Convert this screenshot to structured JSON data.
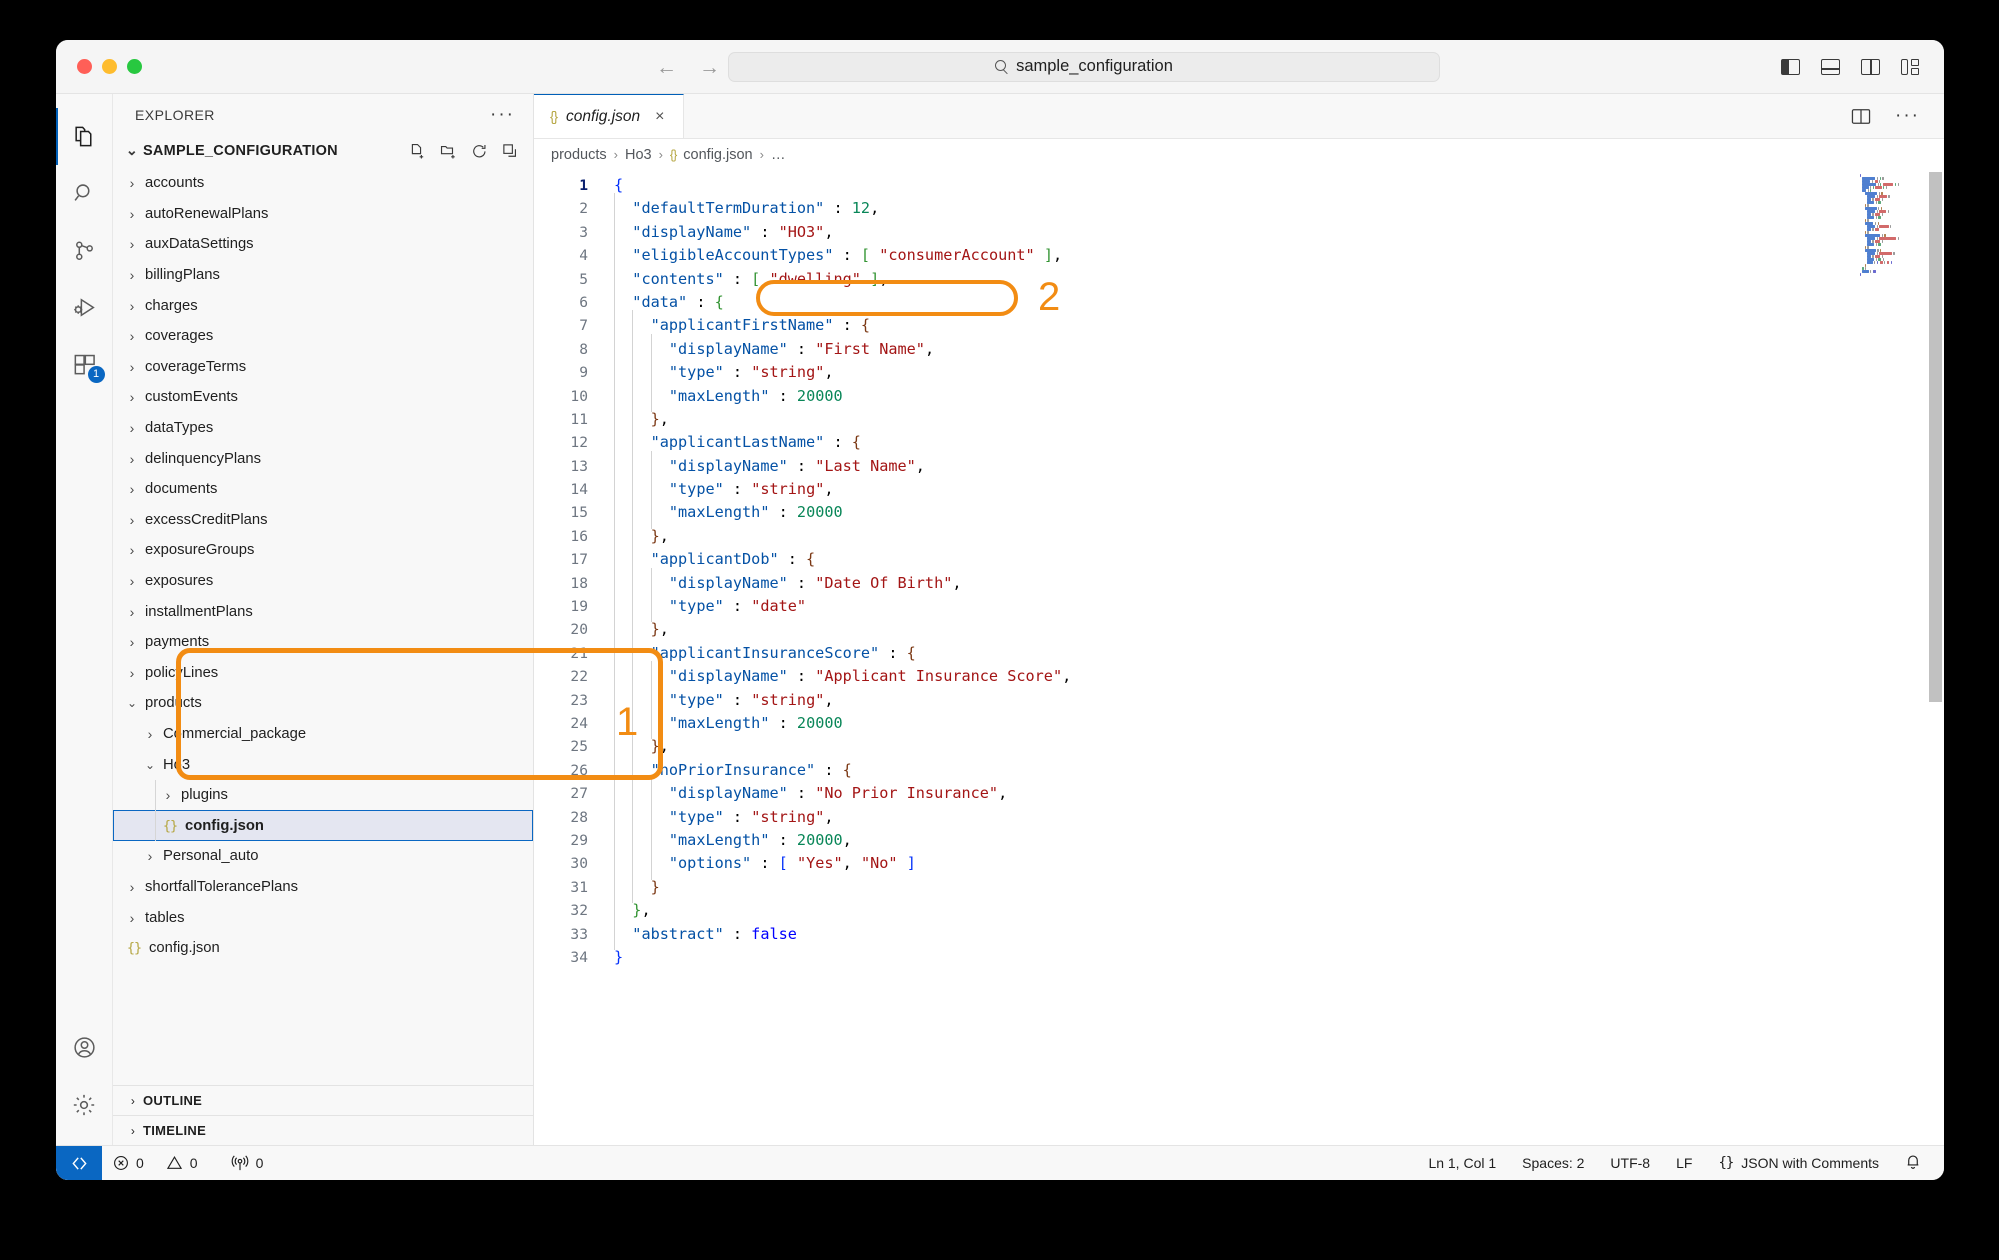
{
  "window": {
    "traffic_lights": [
      "close",
      "minimize",
      "maximize"
    ]
  },
  "titlebar": {
    "back_arrow": "←",
    "forward_arrow": "→",
    "quick_input_value": "sample_configuration",
    "search_icon": "search-icon",
    "layout_icons": [
      "toggle-primary-sidebar-icon",
      "toggle-panel-icon",
      "toggle-secondary-sidebar-icon",
      "customize-layout-icon"
    ]
  },
  "activitybar": {
    "items": [
      {
        "name": "explorer",
        "icon": "files-icon",
        "active": true,
        "badge": ""
      },
      {
        "name": "search",
        "icon": "search-icon",
        "active": false,
        "badge": ""
      },
      {
        "name": "source-control",
        "icon": "source-control-icon",
        "active": false,
        "badge": ""
      },
      {
        "name": "run-and-debug",
        "icon": "run-debug-icon",
        "active": false,
        "badge": ""
      },
      {
        "name": "extensions",
        "icon": "extensions-icon",
        "active": false,
        "badge": "1"
      }
    ],
    "bottom": [
      {
        "name": "accounts",
        "icon": "account-icon"
      },
      {
        "name": "manage",
        "icon": "gear-icon"
      }
    ]
  },
  "sidebar": {
    "title": "EXPLORER",
    "more_actions": "···",
    "root": {
      "label": "SAMPLE_CONFIGURATION",
      "expanded": true,
      "actions": [
        "new-file-icon",
        "new-folder-icon",
        "refresh-icon",
        "collapse-all-icon"
      ]
    },
    "tree": [
      {
        "label": "accounts",
        "type": "folder",
        "depth": 1,
        "expanded": false
      },
      {
        "label": "autoRenewalPlans",
        "type": "folder",
        "depth": 1,
        "expanded": false
      },
      {
        "label": "auxDataSettings",
        "type": "folder",
        "depth": 1,
        "expanded": false
      },
      {
        "label": "billingPlans",
        "type": "folder",
        "depth": 1,
        "expanded": false
      },
      {
        "label": "charges",
        "type": "folder",
        "depth": 1,
        "expanded": false
      },
      {
        "label": "coverages",
        "type": "folder",
        "depth": 1,
        "expanded": false
      },
      {
        "label": "coverageTerms",
        "type": "folder",
        "depth": 1,
        "expanded": false
      },
      {
        "label": "customEvents",
        "type": "folder",
        "depth": 1,
        "expanded": false
      },
      {
        "label": "dataTypes",
        "type": "folder",
        "depth": 1,
        "expanded": false
      },
      {
        "label": "delinquencyPlans",
        "type": "folder",
        "depth": 1,
        "expanded": false
      },
      {
        "label": "documents",
        "type": "folder",
        "depth": 1,
        "expanded": false
      },
      {
        "label": "excessCreditPlans",
        "type": "folder",
        "depth": 1,
        "expanded": false
      },
      {
        "label": "exposureGroups",
        "type": "folder",
        "depth": 1,
        "expanded": false
      },
      {
        "label": "exposures",
        "type": "folder",
        "depth": 1,
        "expanded": false
      },
      {
        "label": "installmentPlans",
        "type": "folder",
        "depth": 1,
        "expanded": false
      },
      {
        "label": "payments",
        "type": "folder",
        "depth": 1,
        "expanded": false
      },
      {
        "label": "policyLines",
        "type": "folder",
        "depth": 1,
        "expanded": false
      },
      {
        "label": "products",
        "type": "folder",
        "depth": 1,
        "expanded": true
      },
      {
        "label": "Commercial_package",
        "type": "folder",
        "depth": 2,
        "expanded": false
      },
      {
        "label": "Ho3",
        "type": "folder",
        "depth": 2,
        "expanded": true
      },
      {
        "label": "plugins",
        "type": "folder",
        "depth": 3,
        "expanded": false
      },
      {
        "label": "config.json",
        "type": "json",
        "depth": 3,
        "selected": true
      },
      {
        "label": "Personal_auto",
        "type": "folder",
        "depth": 2,
        "expanded": false
      },
      {
        "label": "shortfallTolerancePlans",
        "type": "folder",
        "depth": 1,
        "expanded": false
      },
      {
        "label": "tables",
        "type": "folder",
        "depth": 1,
        "expanded": false
      },
      {
        "label": "config.json",
        "type": "json",
        "depth": 1
      }
    ],
    "bottom_panels": [
      {
        "label": "OUTLINE",
        "expanded": false
      },
      {
        "label": "TIMELINE",
        "expanded": false
      }
    ]
  },
  "editor": {
    "tabs": [
      {
        "label": "config.json",
        "icon": "json-icon",
        "active": true,
        "dirty": false,
        "close_label": "×"
      }
    ],
    "tab_actions": [
      "split-editor-icon",
      "more-actions-icon"
    ],
    "breadcrumb": [
      "products",
      "Ho3",
      "config.json",
      "…"
    ],
    "breadcrumb_separator": "›",
    "code_lines": [
      {
        "n": 1,
        "indent": 0,
        "tokens": [
          {
            "t": "{",
            "c": "br1"
          }
        ]
      },
      {
        "n": 2,
        "indent": 1,
        "tokens": [
          {
            "t": "\"defaultTermDuration\"",
            "c": "k"
          },
          {
            "t": " : ",
            "c": "p"
          },
          {
            "t": "12",
            "c": "n"
          },
          {
            "t": ",",
            "c": "p"
          }
        ]
      },
      {
        "n": 3,
        "indent": 1,
        "tokens": [
          {
            "t": "\"displayName\"",
            "c": "k"
          },
          {
            "t": " : ",
            "c": "p"
          },
          {
            "t": "\"HO3\"",
            "c": "s"
          },
          {
            "t": ",",
            "c": "p"
          }
        ]
      },
      {
        "n": 4,
        "indent": 1,
        "tokens": [
          {
            "t": "\"eligibleAccountTypes\"",
            "c": "k"
          },
          {
            "t": " : ",
            "c": "p"
          },
          {
            "t": "[",
            "c": "br2"
          },
          {
            "t": " ",
            "c": "p"
          },
          {
            "t": "\"consumerAccount\"",
            "c": "s"
          },
          {
            "t": " ",
            "c": "p"
          },
          {
            "t": "]",
            "c": "br2"
          },
          {
            "t": ",",
            "c": "p"
          }
        ]
      },
      {
        "n": 5,
        "indent": 1,
        "tokens": [
          {
            "t": "\"contents\"",
            "c": "k"
          },
          {
            "t": " : ",
            "c": "p"
          },
          {
            "t": "[",
            "c": "br2"
          },
          {
            "t": " ",
            "c": "p"
          },
          {
            "t": "\"dwelling\"",
            "c": "s"
          },
          {
            "t": " ",
            "c": "p"
          },
          {
            "t": "]",
            "c": "br2"
          },
          {
            "t": ",",
            "c": "p"
          }
        ]
      },
      {
        "n": 6,
        "indent": 1,
        "tokens": [
          {
            "t": "\"data\"",
            "c": "k"
          },
          {
            "t": " : ",
            "c": "p"
          },
          {
            "t": "{",
            "c": "br2"
          }
        ]
      },
      {
        "n": 7,
        "indent": 2,
        "tokens": [
          {
            "t": "\"applicantFirstName\"",
            "c": "k"
          },
          {
            "t": " : ",
            "c": "p"
          },
          {
            "t": "{",
            "c": "br3"
          }
        ]
      },
      {
        "n": 8,
        "indent": 3,
        "tokens": [
          {
            "t": "\"displayName\"",
            "c": "k"
          },
          {
            "t": " : ",
            "c": "p"
          },
          {
            "t": "\"First Name\"",
            "c": "s"
          },
          {
            "t": ",",
            "c": "p"
          }
        ]
      },
      {
        "n": 9,
        "indent": 3,
        "tokens": [
          {
            "t": "\"type\"",
            "c": "k"
          },
          {
            "t": " : ",
            "c": "p"
          },
          {
            "t": "\"string\"",
            "c": "s"
          },
          {
            "t": ",",
            "c": "p"
          }
        ]
      },
      {
        "n": 10,
        "indent": 3,
        "tokens": [
          {
            "t": "\"maxLength\"",
            "c": "k"
          },
          {
            "t": " : ",
            "c": "p"
          },
          {
            "t": "20000",
            "c": "n"
          }
        ]
      },
      {
        "n": 11,
        "indent": 2,
        "tokens": [
          {
            "t": "}",
            "c": "br3"
          },
          {
            "t": ",",
            "c": "p"
          }
        ]
      },
      {
        "n": 12,
        "indent": 2,
        "tokens": [
          {
            "t": "\"applicantLastName\"",
            "c": "k"
          },
          {
            "t": " : ",
            "c": "p"
          },
          {
            "t": "{",
            "c": "br3"
          }
        ]
      },
      {
        "n": 13,
        "indent": 3,
        "tokens": [
          {
            "t": "\"displayName\"",
            "c": "k"
          },
          {
            "t": " : ",
            "c": "p"
          },
          {
            "t": "\"Last Name\"",
            "c": "s"
          },
          {
            "t": ",",
            "c": "p"
          }
        ]
      },
      {
        "n": 14,
        "indent": 3,
        "tokens": [
          {
            "t": "\"type\"",
            "c": "k"
          },
          {
            "t": " : ",
            "c": "p"
          },
          {
            "t": "\"string\"",
            "c": "s"
          },
          {
            "t": ",",
            "c": "p"
          }
        ]
      },
      {
        "n": 15,
        "indent": 3,
        "tokens": [
          {
            "t": "\"maxLength\"",
            "c": "k"
          },
          {
            "t": " : ",
            "c": "p"
          },
          {
            "t": "20000",
            "c": "n"
          }
        ]
      },
      {
        "n": 16,
        "indent": 2,
        "tokens": [
          {
            "t": "}",
            "c": "br3"
          },
          {
            "t": ",",
            "c": "p"
          }
        ]
      },
      {
        "n": 17,
        "indent": 2,
        "tokens": [
          {
            "t": "\"applicantDob\"",
            "c": "k"
          },
          {
            "t": " : ",
            "c": "p"
          },
          {
            "t": "{",
            "c": "br3"
          }
        ]
      },
      {
        "n": 18,
        "indent": 3,
        "tokens": [
          {
            "t": "\"displayName\"",
            "c": "k"
          },
          {
            "t": " : ",
            "c": "p"
          },
          {
            "t": "\"Date Of Birth\"",
            "c": "s"
          },
          {
            "t": ",",
            "c": "p"
          }
        ]
      },
      {
        "n": 19,
        "indent": 3,
        "tokens": [
          {
            "t": "\"type\"",
            "c": "k"
          },
          {
            "t": " : ",
            "c": "p"
          },
          {
            "t": "\"date\"",
            "c": "s"
          }
        ]
      },
      {
        "n": 20,
        "indent": 2,
        "tokens": [
          {
            "t": "}",
            "c": "br3"
          },
          {
            "t": ",",
            "c": "p"
          }
        ]
      },
      {
        "n": 21,
        "indent": 2,
        "tokens": [
          {
            "t": "\"applicantInsuranceScore\"",
            "c": "k"
          },
          {
            "t": " : ",
            "c": "p"
          },
          {
            "t": "{",
            "c": "br3"
          }
        ]
      },
      {
        "n": 22,
        "indent": 3,
        "tokens": [
          {
            "t": "\"displayName\"",
            "c": "k"
          },
          {
            "t": " : ",
            "c": "p"
          },
          {
            "t": "\"Applicant Insurance Score\"",
            "c": "s"
          },
          {
            "t": ",",
            "c": "p"
          }
        ]
      },
      {
        "n": 23,
        "indent": 3,
        "tokens": [
          {
            "t": "\"type\"",
            "c": "k"
          },
          {
            "t": " : ",
            "c": "p"
          },
          {
            "t": "\"string\"",
            "c": "s"
          },
          {
            "t": ",",
            "c": "p"
          }
        ]
      },
      {
        "n": 24,
        "indent": 3,
        "tokens": [
          {
            "t": "\"maxLength\"",
            "c": "k"
          },
          {
            "t": " : ",
            "c": "p"
          },
          {
            "t": "20000",
            "c": "n"
          }
        ]
      },
      {
        "n": 25,
        "indent": 2,
        "tokens": [
          {
            "t": "}",
            "c": "br3"
          },
          {
            "t": ",",
            "c": "p"
          }
        ]
      },
      {
        "n": 26,
        "indent": 2,
        "tokens": [
          {
            "t": "\"noPriorInsurance\"",
            "c": "k"
          },
          {
            "t": " : ",
            "c": "p"
          },
          {
            "t": "{",
            "c": "br3"
          }
        ]
      },
      {
        "n": 27,
        "indent": 3,
        "tokens": [
          {
            "t": "\"displayName\"",
            "c": "k"
          },
          {
            "t": " : ",
            "c": "p"
          },
          {
            "t": "\"No Prior Insurance\"",
            "c": "s"
          },
          {
            "t": ",",
            "c": "p"
          }
        ]
      },
      {
        "n": 28,
        "indent": 3,
        "tokens": [
          {
            "t": "\"type\"",
            "c": "k"
          },
          {
            "t": " : ",
            "c": "p"
          },
          {
            "t": "\"string\"",
            "c": "s"
          },
          {
            "t": ",",
            "c": "p"
          }
        ]
      },
      {
        "n": 29,
        "indent": 3,
        "tokens": [
          {
            "t": "\"maxLength\"",
            "c": "k"
          },
          {
            "t": " : ",
            "c": "p"
          },
          {
            "t": "20000",
            "c": "n"
          },
          {
            "t": ",",
            "c": "p"
          }
        ]
      },
      {
        "n": 30,
        "indent": 3,
        "tokens": [
          {
            "t": "\"options\"",
            "c": "k"
          },
          {
            "t": " : ",
            "c": "p"
          },
          {
            "t": "[",
            "c": "br1"
          },
          {
            "t": " ",
            "c": "p"
          },
          {
            "t": "\"Yes\"",
            "c": "s"
          },
          {
            "t": ", ",
            "c": "p"
          },
          {
            "t": "\"No\"",
            "c": "s"
          },
          {
            "t": " ",
            "c": "p"
          },
          {
            "t": "]",
            "c": "br1"
          }
        ]
      },
      {
        "n": 31,
        "indent": 2,
        "tokens": [
          {
            "t": "}",
            "c": "br3"
          }
        ]
      },
      {
        "n": 32,
        "indent": 1,
        "tokens": [
          {
            "t": "}",
            "c": "br2"
          },
          {
            "t": ",",
            "c": "p"
          }
        ]
      },
      {
        "n": 33,
        "indent": 1,
        "tokens": [
          {
            "t": "\"abstract\"",
            "c": "k"
          },
          {
            "t": " : ",
            "c": "p"
          },
          {
            "t": "false",
            "c": "b"
          }
        ]
      },
      {
        "n": 34,
        "indent": 0,
        "tokens": [
          {
            "t": "}",
            "c": "br1"
          }
        ]
      }
    ],
    "current_line": 1
  },
  "statusbar": {
    "remote_icon": "remote-window-icon",
    "left": [
      {
        "name": "errors",
        "icon": "error-icon",
        "value": "0"
      },
      {
        "name": "warnings",
        "icon": "warning-icon",
        "value": "0"
      },
      {
        "name": "ports",
        "icon": "radio-tower-icon",
        "value": "0"
      }
    ],
    "right": [
      {
        "name": "cursor-position",
        "label": "Ln 1, Col 1"
      },
      {
        "name": "indentation",
        "label": "Spaces: 2"
      },
      {
        "name": "encoding",
        "label": "UTF-8"
      },
      {
        "name": "eol",
        "label": "LF"
      },
      {
        "name": "language-mode",
        "label": "JSON with Comments",
        "icon": "json-icon"
      },
      {
        "name": "notifications",
        "label": "",
        "icon": "bell-icon"
      }
    ]
  },
  "annotations": [
    {
      "number": "1",
      "target": "products-Ho3-config-json-tree-region",
      "color": "#f28c13"
    },
    {
      "number": "2",
      "target": "contents-dwelling-code-line",
      "color": "#f28c13"
    }
  ]
}
